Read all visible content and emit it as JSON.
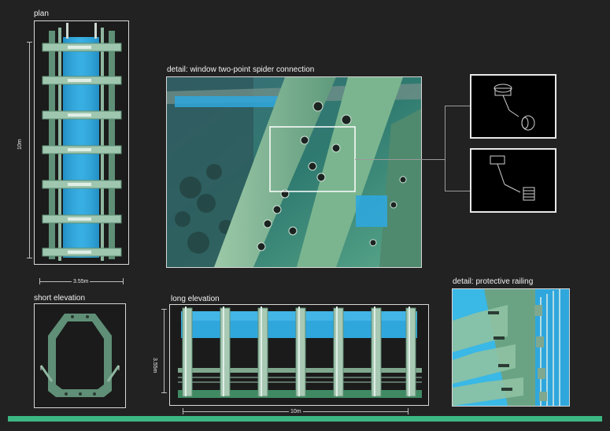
{
  "sections": {
    "plan": "plan",
    "detail_spider": "detail: window two-point spider connection",
    "short_elevation": "short elevation",
    "long_elevation": "long elevation",
    "detail_railing": "detail: protective railing"
  },
  "dimensions": {
    "plan_height": "10m",
    "plan_width": "3.55m",
    "long_height": "3.55m",
    "long_length": "10m"
  },
  "colors": {
    "background": "#232222",
    "accent_bar": "#3cb784",
    "glass": "#2fa7dd",
    "steel": "#7fa88f"
  }
}
